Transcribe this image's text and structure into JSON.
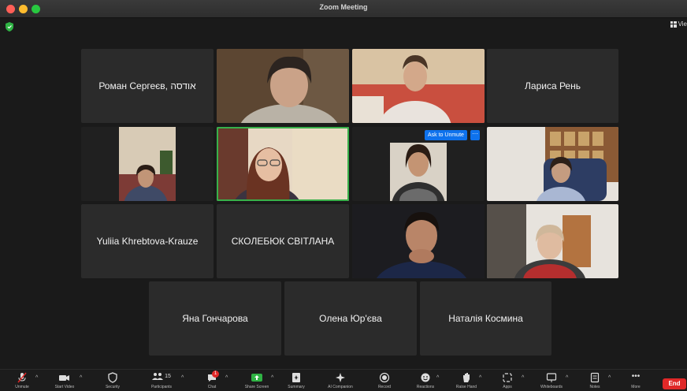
{
  "window": {
    "title": "Zoom Meeting",
    "view_label": "Vie"
  },
  "tiles": {
    "t1": "Роман Сергеєв, אודסה",
    "t4": "Лариса Рень",
    "t9": "Yuliia Khrebtova-Krauze",
    "t10": "СКОЛЕБЮК СВІТЛАНА",
    "t13": "Яна Гончарова",
    "t14": "Олена Юр'єва",
    "t15": "Наталія Космина"
  },
  "ask_unmute": {
    "label": "Ask to Unmute",
    "more": "···"
  },
  "toolbar": {
    "participants_count": "15",
    "chat_badge": "1",
    "labels": {
      "unmute": "Unmute",
      "video": "Start Video",
      "security": "Security",
      "participants": "Participants",
      "chat": "Chat",
      "share": "Share Screen",
      "summary": "Summary",
      "companion": "AI Companion",
      "record": "Record",
      "reactions": "Reactions",
      "raise_hand": "Raise Hand",
      "apps": "Apps",
      "whiteboards": "Whiteboards",
      "notes": "Notes",
      "more": "More"
    },
    "end": "End"
  },
  "colors": {
    "accent": "#0e72ed",
    "active_speaker": "#38b04a",
    "end_button": "#e02828",
    "tile_bg": "#2b2b2b"
  }
}
